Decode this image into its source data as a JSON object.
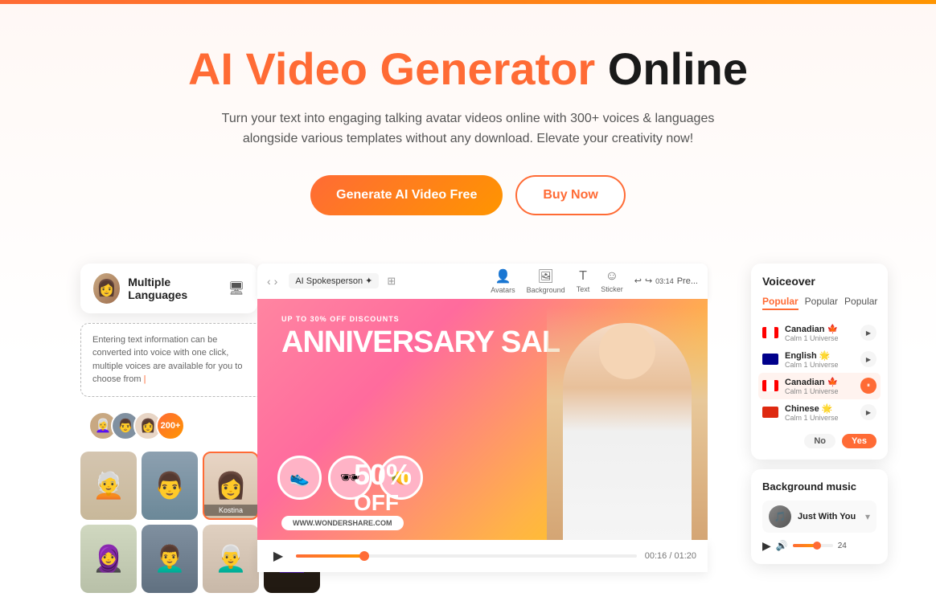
{
  "topbar": {
    "color": "#ff6b35"
  },
  "hero": {
    "title_orange": "AI Video Generator",
    "title_black": "Online",
    "subtitle": "Turn your text into engaging talking avatar videos online with 300+ voices & languages alongside various templates without any download. Elevate your creativity now!",
    "btn_primary": "Generate AI Video Free",
    "btn_outline": "Buy Now"
  },
  "left_panel": {
    "lang_card": {
      "label": "Multiple Languages"
    },
    "text_card": {
      "content": "Entering text information can be converted into voice with one click, multiple voices are available for you to choose from"
    },
    "avatar_count": "200+",
    "avatars": [
      {
        "id": 1,
        "color": "#c8a882",
        "selected": false
      },
      {
        "id": 2,
        "color": "#8090a0",
        "selected": false
      },
      {
        "id": 3,
        "color": "#e8d5c5",
        "selected": true,
        "label": "Kostina"
      },
      {
        "id": 4,
        "color": "#c8a8a0",
        "selected": false
      },
      {
        "id": 5,
        "color": "#d0d8c0",
        "selected": false
      },
      {
        "id": 6,
        "color": "#607080",
        "selected": false
      },
      {
        "id": 7,
        "color": "#e0d0c0",
        "selected": false
      },
      {
        "id": 8,
        "color": "#201810",
        "selected": false
      }
    ]
  },
  "center_panel": {
    "toolbar": {
      "back": "‹",
      "forward": "›",
      "ai_label": "AI Spokesperson",
      "tabs": [
        "Avatars",
        "Background",
        "Text",
        "Sticker"
      ]
    },
    "video": {
      "discount_text": "UP TO 30% OFF DISCOUNTS",
      "sale_text": "ANNIVERSARY SAL",
      "percent": "50%",
      "off": "OFF",
      "url": "WWW.WONDERSHARE.COM"
    },
    "controls": {
      "time": "00:16 / 01:20",
      "progress": 20
    }
  },
  "right_panel": {
    "voiceover": {
      "title": "Voiceover",
      "tabs": [
        "Popular",
        "Popular",
        "Popular"
      ],
      "voices": [
        {
          "flag": "ca",
          "name": "Canadian 🍁",
          "sub": "Calm 1 Universe",
          "active": false
        },
        {
          "flag": "au",
          "name": "English 🌟",
          "sub": "Calm 1 Universe",
          "active": false
        },
        {
          "flag": "ca",
          "name": "Canadian 🍁",
          "sub": "Calm 1 Universe",
          "active": true,
          "highlighted": true
        },
        {
          "flag": "cn",
          "name": "Chinese 🌟",
          "sub": "Calm 1 Universe",
          "active": false
        }
      ],
      "no_label": "No",
      "yes_label": "Yes"
    },
    "bg_music": {
      "title": "Background music",
      "track_name": "Just With You",
      "volume": 24
    }
  }
}
